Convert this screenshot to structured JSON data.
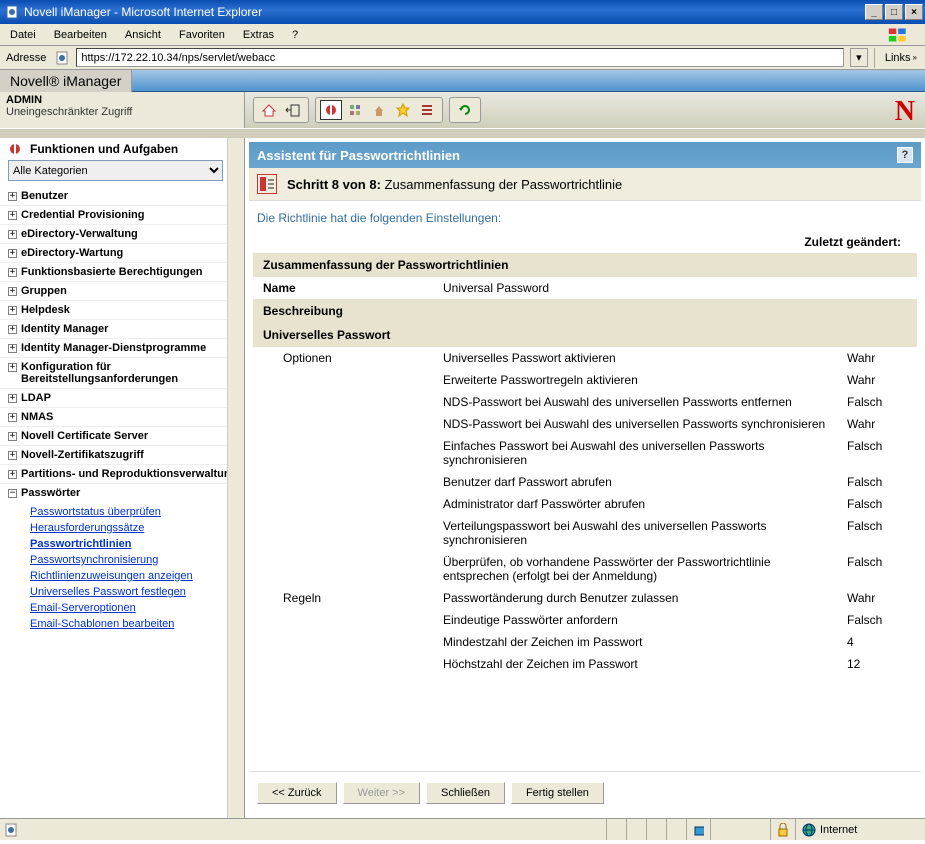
{
  "window": {
    "title": "Novell iManager - Microsoft Internet Explorer",
    "menus": [
      "Datei",
      "Bearbeiten",
      "Ansicht",
      "Favoriten",
      "Extras",
      "?"
    ],
    "address_label": "Adresse",
    "address_value": "https://172.22.10.34/nps/servlet/webacc",
    "links_label": "Links"
  },
  "app": {
    "brand": "Novell® iManager",
    "user": "ADMIN",
    "access": "Uneingeschränkter Zugriff"
  },
  "sidebar": {
    "header": "Funktionen und Aufgaben",
    "category": "Alle Kategorien",
    "items": [
      {
        "label": "Benutzer",
        "expanded": false
      },
      {
        "label": "Credential Provisioning",
        "expanded": false
      },
      {
        "label": "eDirectory-Verwaltung",
        "expanded": false
      },
      {
        "label": "eDirectory-Wartung",
        "expanded": false
      },
      {
        "label": "Funktionsbasierte Berechtigungen",
        "expanded": false
      },
      {
        "label": "Gruppen",
        "expanded": false
      },
      {
        "label": "Helpdesk",
        "expanded": false
      },
      {
        "label": "Identity Manager",
        "expanded": false
      },
      {
        "label": "Identity Manager-Dienstprogramme",
        "expanded": false
      },
      {
        "label": "Konfiguration für Bereitstellungsanforderungen",
        "expanded": false
      },
      {
        "label": "LDAP",
        "expanded": false
      },
      {
        "label": "NMAS",
        "expanded": false
      },
      {
        "label": "Novell Certificate Server",
        "expanded": false
      },
      {
        "label": "Novell-Zertifikatszugriff",
        "expanded": false
      },
      {
        "label": "Partitions- und Reproduktionsverwaltung",
        "expanded": false
      },
      {
        "label": "Passwörter",
        "expanded": true,
        "children": [
          {
            "label": "Passwortstatus überprüfen",
            "active": false
          },
          {
            "label": "Herausforderungssätze",
            "active": false
          },
          {
            "label": "Passwortrichtlinien",
            "active": true
          },
          {
            "label": "Passwortsynchronisierung",
            "active": false
          },
          {
            "label": "Richtlinienzuweisungen anzeigen",
            "active": false
          },
          {
            "label": "Universelles Passwort festlegen",
            "active": false
          },
          {
            "label": "Email-Serveroptionen",
            "active": false
          },
          {
            "label": "Email-Schablonen bearbeiten",
            "active": false
          }
        ]
      }
    ]
  },
  "content": {
    "wizard_title": "Assistent für Passwortrichtlinien",
    "step_label": "Schritt 8 von 8:",
    "step_desc": "Zusammenfassung der Passwortrichtlinie",
    "intro": "Die Richtlinie hat die folgenden Einstellungen:",
    "modified_label": "Zuletzt geändert:",
    "summary": {
      "title": "Zusammenfassung der Passwortrichtlinien",
      "name_label": "Name",
      "name_value": "Universal Password",
      "desc_label": "Beschreibung",
      "up_label": "Universelles Passwort",
      "opt_label": "Optionen",
      "options": [
        {
          "label": "Universelles Passwort aktivieren",
          "value": "Wahr"
        },
        {
          "label": "Erweiterte Passwortregeln aktivieren",
          "value": "Wahr"
        },
        {
          "label": "NDS-Passwort bei Auswahl des universellen Passworts entfernen",
          "value": "Falsch"
        },
        {
          "label": "NDS-Passwort bei Auswahl des universellen Passworts synchronisieren",
          "value": "Wahr"
        },
        {
          "label": "Einfaches Passwort bei Auswahl des universellen Passworts synchronisieren",
          "value": "Falsch"
        },
        {
          "label": "Benutzer darf Passwort abrufen",
          "value": "Falsch"
        },
        {
          "label": "Administrator darf Passwörter abrufen",
          "value": "Falsch"
        },
        {
          "label": "Verteilungspasswort bei Auswahl des universellen Passworts synchronisieren",
          "value": "Falsch"
        },
        {
          "label": "Überprüfen, ob vorhandene Passwörter der Passwortrichtlinie entsprechen (erfolgt bei der Anmeldung)",
          "value": "Falsch"
        }
      ],
      "rules_label": "Regeln",
      "rules": [
        {
          "label": "Passwortänderung durch Benutzer zulassen",
          "value": "Wahr"
        },
        {
          "label": "Eindeutige Passwörter anfordern",
          "value": "Falsch"
        },
        {
          "label": "Mindestzahl der Zeichen im Passwort",
          "value": "4"
        },
        {
          "label": "Höchstzahl der Zeichen im Passwort",
          "value": "12"
        }
      ]
    },
    "buttons": {
      "back": "<< Zurück",
      "next": "Weiter >>",
      "close": "Schließen",
      "finish": "Fertig stellen"
    }
  },
  "statusbar": {
    "zone": "Internet"
  }
}
